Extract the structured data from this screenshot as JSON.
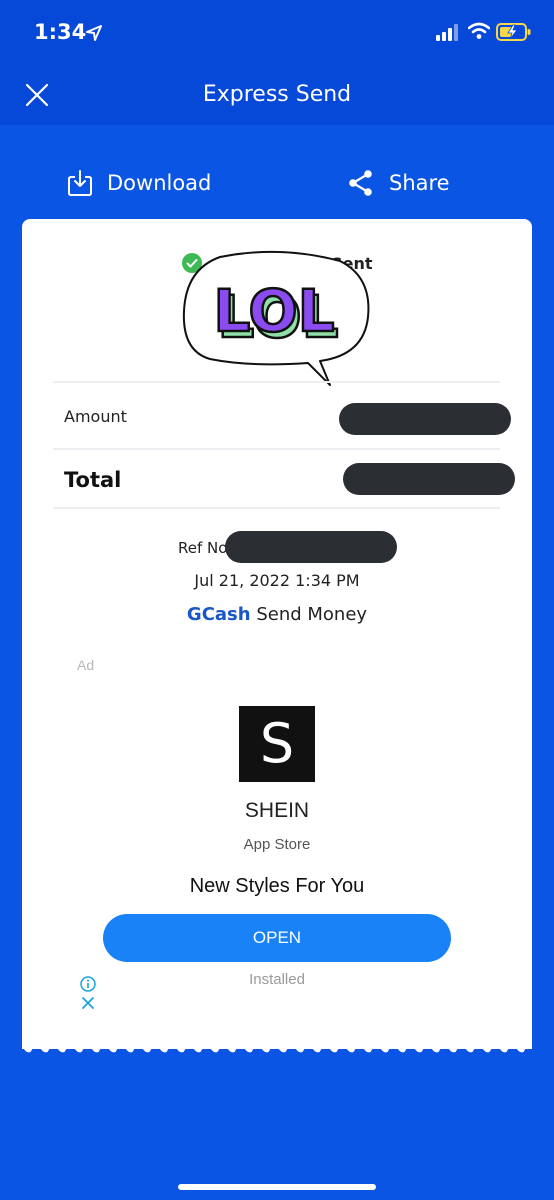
{
  "status_bar": {
    "time": "1:34",
    "icons": [
      "location-arrow-icon",
      "signal-icon",
      "wifi-icon",
      "battery-charging-icon"
    ]
  },
  "nav": {
    "title": "Express Send",
    "close_icon": "close-icon"
  },
  "actions": {
    "download_label": "Download",
    "share_label": "Share"
  },
  "receipt": {
    "status": "Successfully Sent",
    "sticker_text": "LOL",
    "amount_label": "Amount",
    "total_label": "Total",
    "ref_label": "Ref No",
    "datetime": "Jul 21, 2022 1:34 PM",
    "service_brand": "GCash",
    "service_name": "Send Money"
  },
  "ad": {
    "label": "Ad",
    "logo_letter": "S",
    "name": "SHEIN",
    "store": "App Store",
    "tagline": "New Styles For You",
    "button": "OPEN",
    "status": "Installed"
  },
  "colors": {
    "background": "#0a55e4",
    "header": "#0648d8",
    "gcash_blue": "#1a57c6",
    "open_button": "#1a82f7",
    "success_green": "#3dba55",
    "sticker_purple": "#8a4cf0",
    "sticker_green": "#8fe0a8"
  }
}
